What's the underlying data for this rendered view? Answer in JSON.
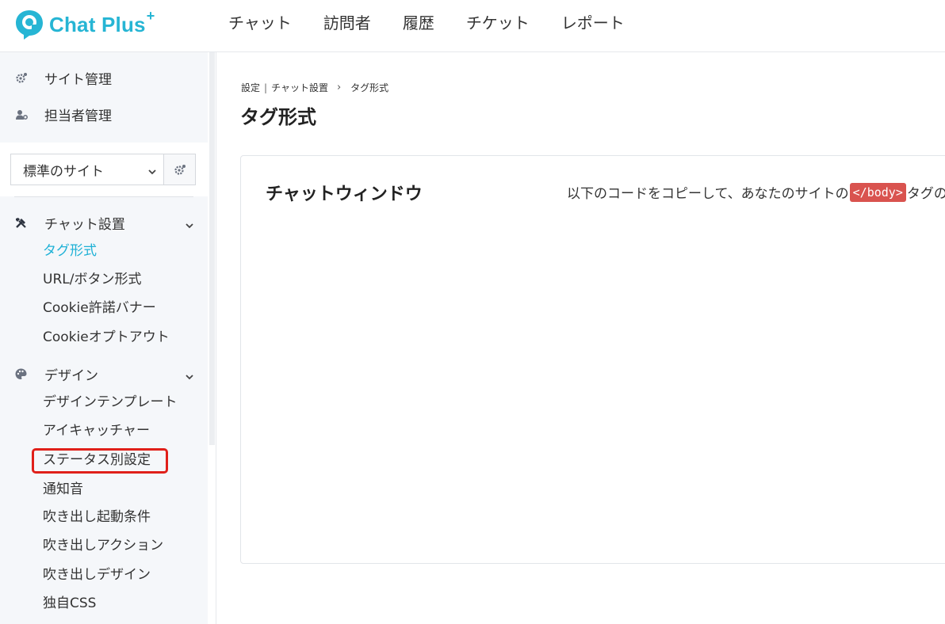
{
  "brand": {
    "name": "Chat Plus",
    "plus": "+"
  },
  "topnav": [
    "チャット",
    "訪問者",
    "履歴",
    "チケット",
    "レポート"
  ],
  "sidebar": {
    "top_items": [
      {
        "label": "サイト管理",
        "icon": "gear-icon"
      },
      {
        "label": "担当者管理",
        "icon": "users-gear-icon"
      }
    ],
    "site_select": {
      "value": "標準のサイト"
    },
    "sections": [
      {
        "label": "チャット設置",
        "icon": "tools-icon",
        "items": [
          "タグ形式",
          "URL/ボタン形式",
          "Cookie許諾バナー",
          "Cookieオプトアウト"
        ]
      },
      {
        "label": "デザイン",
        "icon": "palette-icon",
        "items": [
          "デザインテンプレート",
          "アイキャッチャー",
          "ステータス別設定",
          "通知音",
          "吹き出し起動条件",
          "吹き出しアクション",
          "吹き出しデザイン",
          "独自CSS"
        ]
      }
    ]
  },
  "breadcrumb": {
    "a": "設定",
    "b": "チャット設置",
    "c": "タグ形式"
  },
  "page": {
    "title": "タグ形式"
  },
  "card": {
    "title": "チャットウィンドウ",
    "desc_before": "以下のコードをコピーして、あなたのサイトの",
    "code": "</body>",
    "desc_after": "タグの"
  },
  "colors": {
    "brand": "#26b5d4",
    "active": "#1fb1d6",
    "highlight": "#e0201a",
    "code_bg": "#d9534f"
  }
}
